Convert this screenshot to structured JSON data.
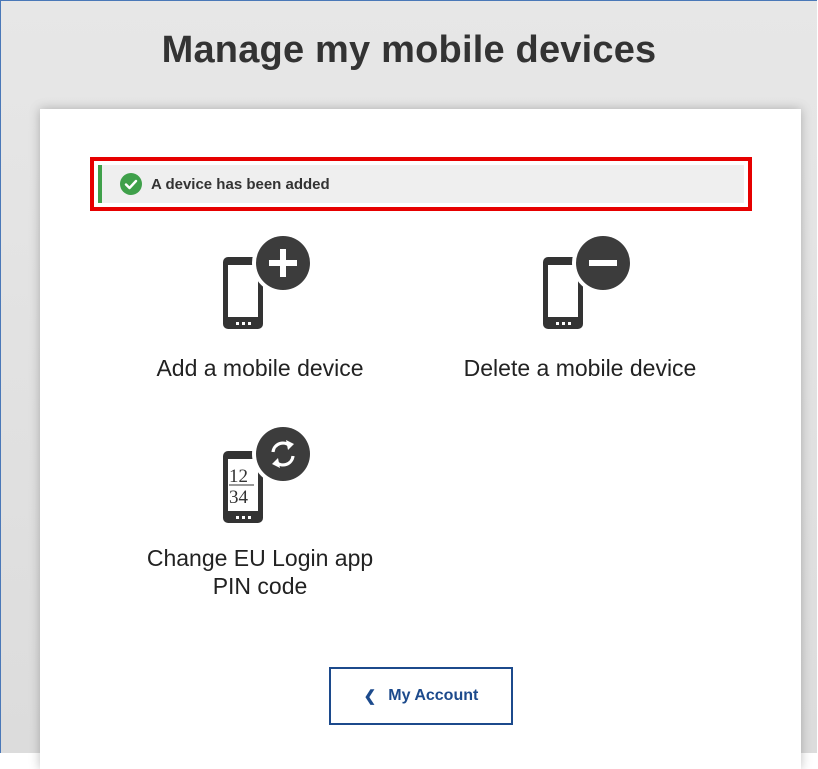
{
  "page": {
    "title": "Manage my mobile devices"
  },
  "alert": {
    "message": "A device has been added",
    "icon": "check-circle-icon",
    "status_color": "#3fa04a",
    "highlight_color": "#e60000"
  },
  "options": [
    {
      "label": "Add a mobile device",
      "icon": "phone-add-icon"
    },
    {
      "label": "Delete a mobile device",
      "icon": "phone-remove-icon"
    },
    {
      "label_line1": "Change EU Login app",
      "label_line2": "PIN code",
      "icon": "phone-pin-refresh-icon",
      "pin_digits_top": "12",
      "pin_digits_bottom": "34"
    }
  ],
  "nav": {
    "back_label": "My Account",
    "back_icon": "chevron-left-icon",
    "accent": "#1c4a8c"
  }
}
